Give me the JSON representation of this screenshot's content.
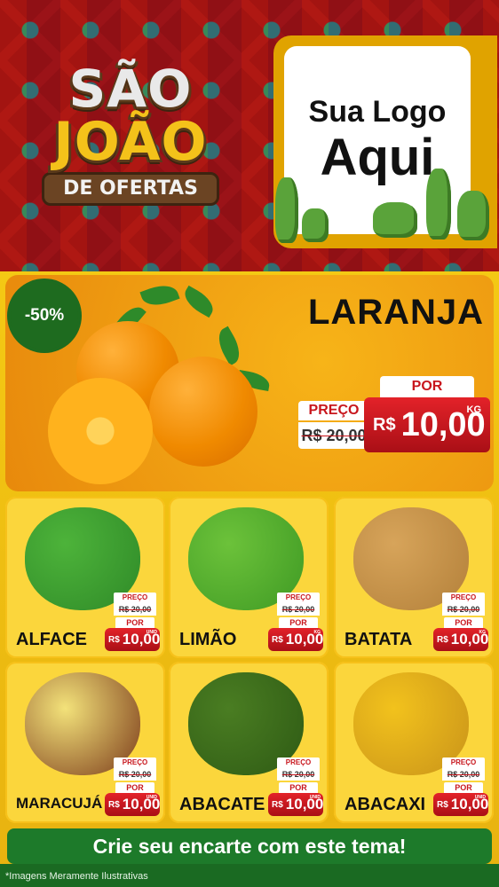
{
  "header": {
    "title_line1": "SÃO",
    "title_line2": "JOÃO",
    "title_line3": "DE OFERTAS",
    "logo_line1": "Sua Logo",
    "logo_line2": "Aqui"
  },
  "featured": {
    "discount": "-50%",
    "name": "LARANJA",
    "preco_label": "PREÇO",
    "old_price": "R$ 20,00",
    "por_label": "POR",
    "currency": "R$",
    "price": "10,00",
    "unit": "KG"
  },
  "products": [
    {
      "name": "ALFACE",
      "preco_label": "PREÇO",
      "old_price": "R$ 20,00",
      "por_label": "POR",
      "currency": "R$",
      "price": "10,00",
      "unit": "UNID"
    },
    {
      "name": "LIMÃO",
      "preco_label": "PREÇO",
      "old_price": "R$ 20,00",
      "por_label": "POR",
      "currency": "R$",
      "price": "10,00",
      "unit": "KG"
    },
    {
      "name": "BATATA",
      "preco_label": "PREÇO",
      "old_price": "R$ 20,00",
      "por_label": "POR",
      "currency": "R$",
      "price": "10,00",
      "unit": "KG"
    },
    {
      "name": "MARACUJÁ",
      "preco_label": "PREÇO",
      "old_price": "R$ 20,00",
      "por_label": "POR",
      "currency": "R$",
      "price": "10,00",
      "unit": "UNID"
    },
    {
      "name": "ABACATE",
      "preco_label": "PREÇO",
      "old_price": "R$ 20,00",
      "por_label": "POR",
      "currency": "R$",
      "price": "10,00",
      "unit": "UNID"
    },
    {
      "name": "ABACAXI",
      "preco_label": "PREÇO",
      "old_price": "R$ 20,00",
      "por_label": "POR",
      "currency": "R$",
      "price": "10,00",
      "unit": "UNID"
    }
  ],
  "footer": {
    "cta": "Crie seu encarte com este tema!",
    "disclaimer": "*Imagens Meramente Ilustrativas"
  },
  "colors": {
    "brand_red": "#c8161d",
    "brand_green": "#1d7a2a",
    "brand_yellow": "#f4c914"
  }
}
